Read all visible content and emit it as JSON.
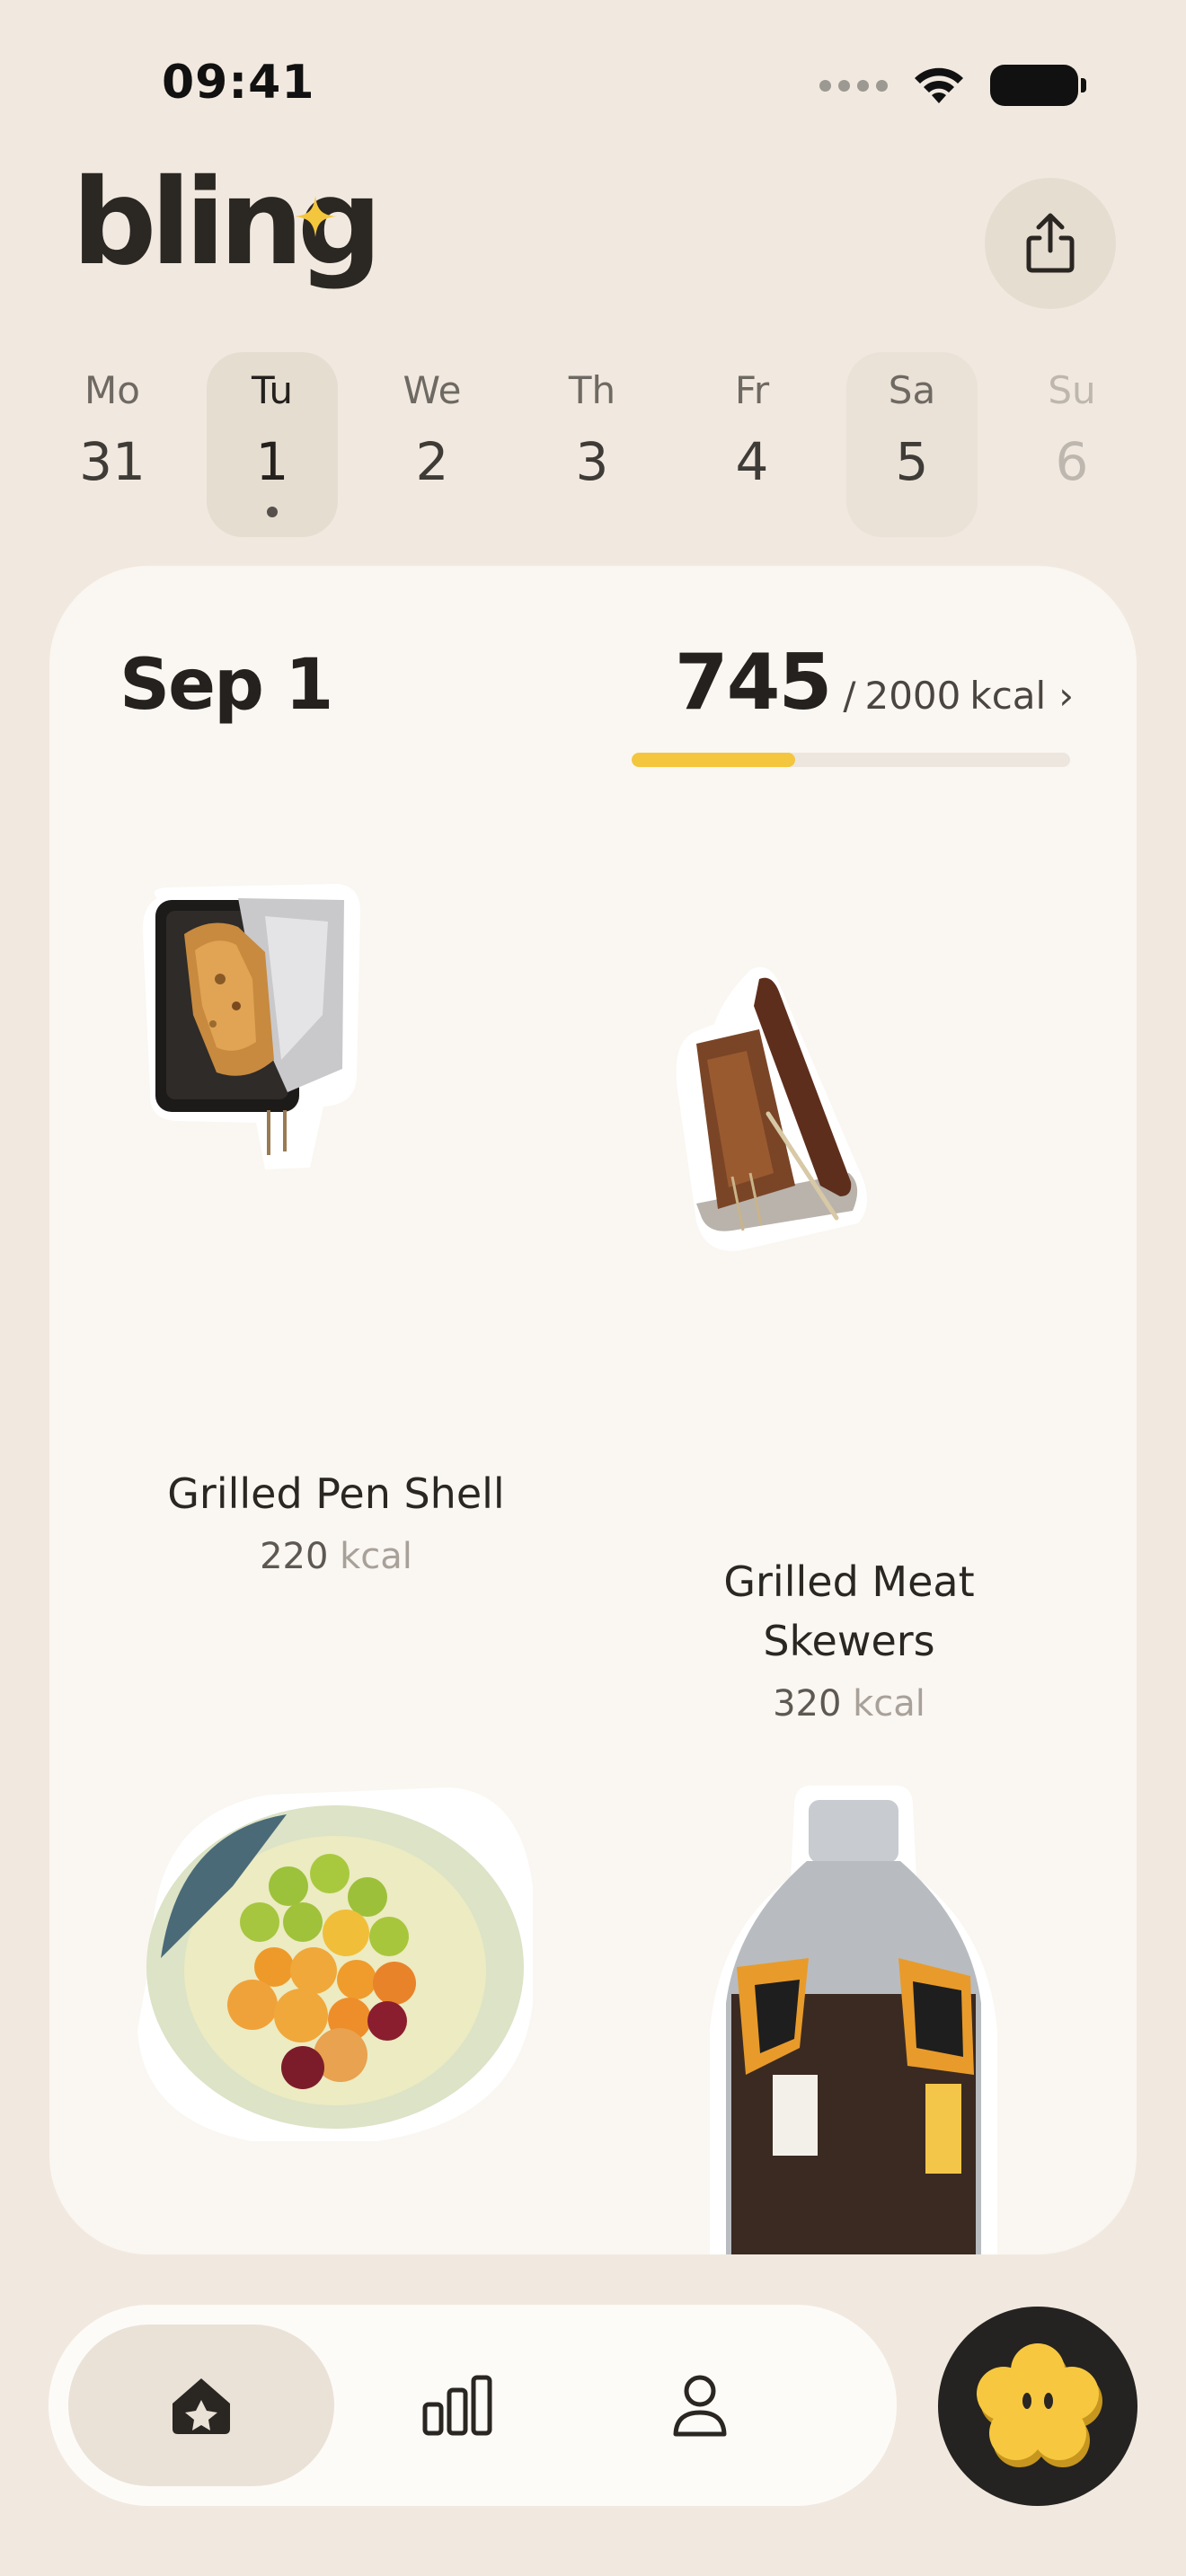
{
  "status_bar": {
    "time": "09:41",
    "icons": [
      "signal-icon",
      "wifi-icon",
      "battery-icon"
    ]
  },
  "header": {
    "app_name": "bling",
    "share_icon": "share-icon"
  },
  "week": {
    "days": [
      {
        "name": "Mo",
        "num": "31",
        "state": "normal"
      },
      {
        "name": "Tu",
        "num": "1",
        "state": "selected"
      },
      {
        "name": "We",
        "num": "2",
        "state": "normal"
      },
      {
        "name": "Th",
        "num": "3",
        "state": "normal"
      },
      {
        "name": "Fr",
        "num": "4",
        "state": "normal"
      },
      {
        "name": "Sa",
        "num": "5",
        "state": "today"
      },
      {
        "name": "Su",
        "num": "6",
        "state": "future"
      }
    ]
  },
  "day_summary": {
    "date_label": "Sep 1",
    "kcal_current": "745",
    "kcal_separator": "/",
    "kcal_goal": "2000",
    "kcal_unit": "kcal",
    "chevron": "›",
    "progress_fraction": 0.3725
  },
  "foods": [
    {
      "name": "Grilled Pen Shell",
      "kcal": "220",
      "unit": "kcal",
      "image": "grilled-pen-shell-photo"
    },
    {
      "name": "Grilled Meat Skewers",
      "kcal": "320",
      "unit": "kcal",
      "image": "grilled-meat-skewers-photo"
    },
    {
      "name": "",
      "kcal": "",
      "unit": "",
      "image": "fruit-bowl-photo"
    },
    {
      "name": "",
      "kcal": "",
      "unit": "",
      "image": "iced-tea-bottle-photo"
    }
  ],
  "bottom_nav": {
    "items": [
      {
        "icon": "home-icon",
        "active": true
      },
      {
        "icon": "bar-chart-icon",
        "active": false
      },
      {
        "icon": "profile-icon",
        "active": false
      }
    ],
    "fab_icon": "flower-mascot-icon"
  },
  "colors": {
    "background": "#F1E9DF",
    "card": "#FAF6F1",
    "accent": "#F4C63E",
    "dark": "#252321"
  }
}
